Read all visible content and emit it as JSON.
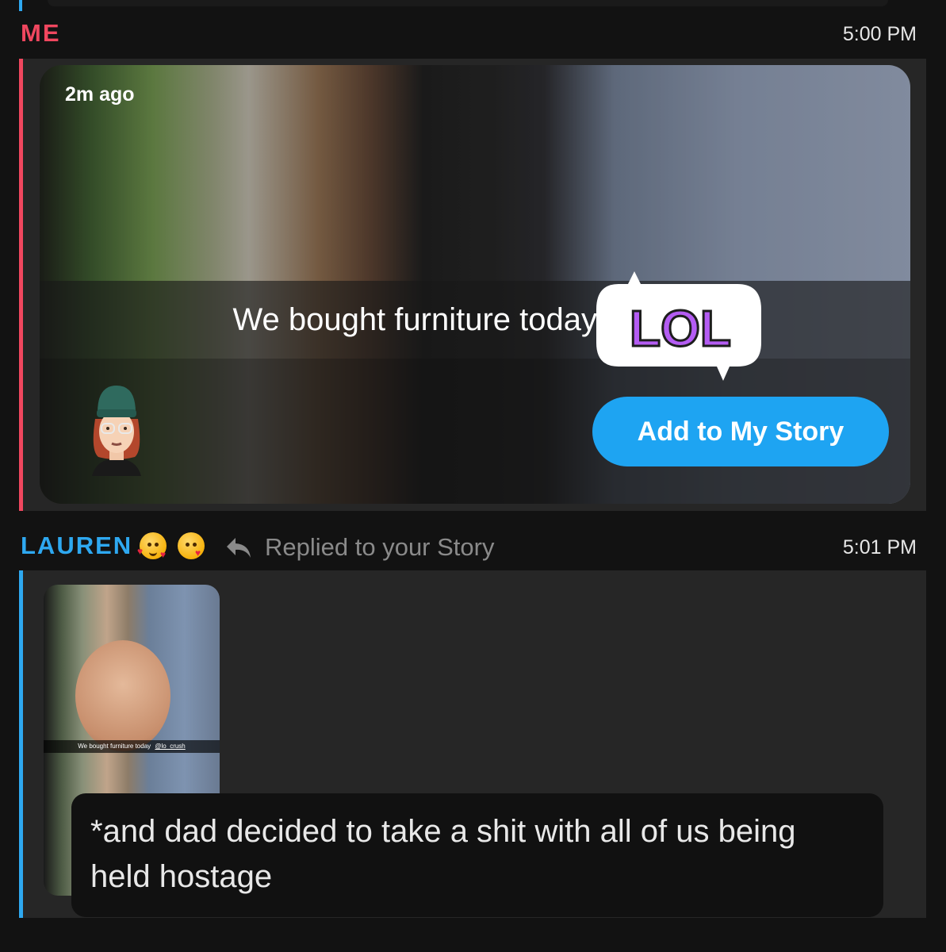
{
  "message_1": {
    "sender": "ME",
    "time": "5:00 PM",
    "snap": {
      "time_ago": "2m ago",
      "caption": "We bought furniture today",
      "sticker_text": "LOL",
      "add_story_label": "Add to My Story"
    },
    "colors": {
      "sender": "#f0475f",
      "button": "#1ea4f2"
    }
  },
  "message_2": {
    "sender": "LAUREN",
    "sender_emojis": [
      "smiling-face-with-hearts-icon",
      "face-blowing-kiss-icon"
    ],
    "reply_label": "Replied to your Story",
    "time": "5:01 PM",
    "thumbnail": {
      "caption": "We bought furniture today",
      "mention": "@lo_crush"
    },
    "reply_text": "*and dad decided to take a shit with all of us being held hostage",
    "colors": {
      "sender": "#2ea8f0"
    }
  }
}
